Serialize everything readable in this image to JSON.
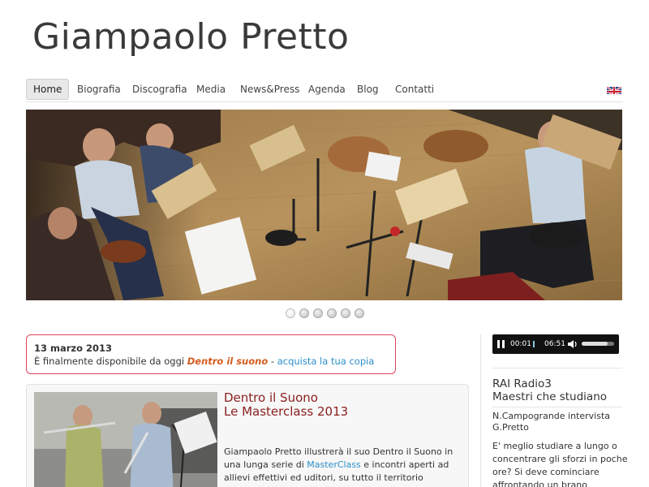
{
  "header": {
    "site_title": "Giampaolo Pretto"
  },
  "nav": {
    "items": [
      {
        "label": "Home",
        "active": true
      },
      {
        "label": "Biografia"
      },
      {
        "label": "Discografia"
      },
      {
        "label": "Media"
      },
      {
        "label": "News&Press"
      },
      {
        "label": "Agenda"
      },
      {
        "label": "Blog"
      },
      {
        "label": "Contatti"
      }
    ],
    "language_icon": "uk-flag-icon"
  },
  "slider": {
    "slide_count": 6,
    "active_index": 0
  },
  "notice": {
    "date": "13 marzo 2013",
    "text_before": "È finalmente disponibile da oggi ",
    "title": "Dentro il suono",
    "separator": " - ",
    "link": "acquista la tua copia"
  },
  "article": {
    "title_line1": "Dentro il Suono",
    "title_line2": "Le Masterclass 2013",
    "text_before": "Giampaolo Pretto illustrerà il suo Dentro il Suono in una lunga serie di ",
    "link": "MasterClass",
    "text_after": " e incontri aperti ad allievi effettivi ed uditori, su tutto il territorio nazionale."
  },
  "sidebar": {
    "player": {
      "elapsed": "00:01",
      "duration": "06:51",
      "volume": 0.8
    },
    "title_line1": "RAI Radio3",
    "title_line2": "Maestri che studiano",
    "sub_line1": "N.Campogrande intervista",
    "sub_line2": "G.Pretto",
    "text": "E' meglio studiare a lungo o concentrare gli sforzi in poche ore? Si deve cominciare affrontando un brano"
  },
  "colors": {
    "notice_border": "#e0455a",
    "link": "#2a8ec9",
    "article_title": "#8a1e1e",
    "highlight": "#d55a1f"
  }
}
